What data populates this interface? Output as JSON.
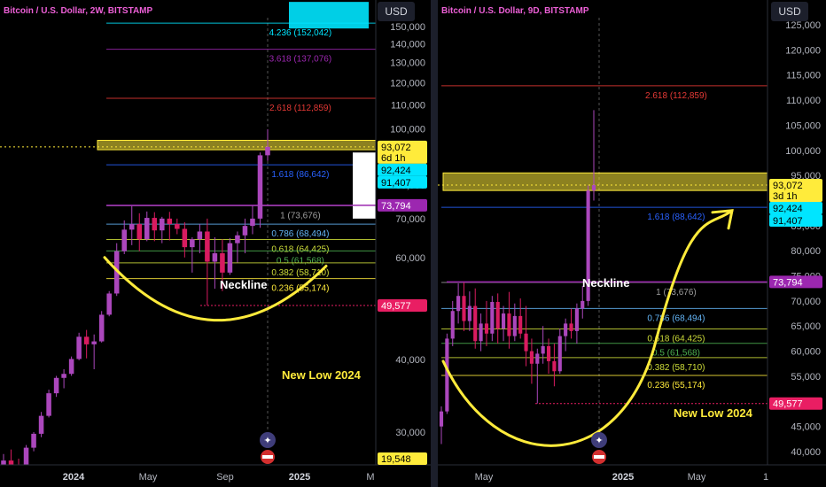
{
  "panels": [
    {
      "name": "left",
      "header": "Bitcoin / U.S. Dollar, 2W, BITSTAMP",
      "currency": "USD",
      "y_ticks": [
        150000,
        140000,
        130000,
        120000,
        110000,
        100000,
        90000,
        80000,
        70000,
        60000,
        50000,
        40000,
        30000
      ],
      "y_tick_labels": [
        "150,000",
        "140,000",
        "130,000",
        "120,000",
        "110,000",
        "100,000",
        "90,000",
        "80,000",
        "70,000",
        "60,000",
        "50,000",
        "40,000",
        "30,000"
      ],
      "x_labels": [
        {
          "text": "2024",
          "bold": true
        },
        {
          "text": "May"
        },
        {
          "text": "Sep"
        },
        {
          "text": "2025",
          "bold": true
        },
        {
          "text": "M"
        }
      ],
      "fib_levels": [
        {
          "label": "4.236 (152,042)",
          "value": 152042,
          "color": "#00e5ff"
        },
        {
          "label": "3.618 (137,076)",
          "value": 137076,
          "color": "#9c27b0"
        },
        {
          "label": "2.618 (112,859)",
          "value": 112859,
          "color": "#e53935"
        },
        {
          "label": "1.618 (86,642)",
          "value": 86642,
          "color": "#2962ff"
        },
        {
          "label": "1 (73,676)",
          "value": 73676,
          "color": "#9e9e9e"
        },
        {
          "label": "0.786 (68,494)",
          "value": 68494,
          "color": "#64b5f6"
        },
        {
          "label": "0.618 (64,425)",
          "value": 64425,
          "color": "#cddc39"
        },
        {
          "label": "0.5 (61,568)",
          "value": 61568,
          "color": "#4caf50"
        },
        {
          "label": "0.382 (58,710)",
          "value": 58710,
          "color": "#cddc39"
        },
        {
          "label": "0.236 (55,174)",
          "value": 55174,
          "color": "#ffeb3b"
        }
      ],
      "neckline_label": "Neckline",
      "new_low_label": "New Low 2024",
      "price_tags": [
        {
          "text": "93,072",
          "sub": "6d 1h",
          "bg": "#ffeb3b",
          "fg": "#000"
        },
        {
          "text": "92,424",
          "bg": "#00e5ff",
          "fg": "#000"
        },
        {
          "text": "91,407",
          "bg": "#00e5ff",
          "fg": "#000"
        },
        {
          "text": "73,794",
          "bg": "#9c27b0",
          "fg": "#fff"
        },
        {
          "text": "49,577",
          "bg": "#e91e63",
          "fg": "#fff"
        },
        {
          "text": "19,548",
          "bg": "#ffeb3b",
          "fg": "#000"
        }
      ]
    },
    {
      "name": "right",
      "header": "Bitcoin / U.S. Dollar, 9D, BITSTAMP",
      "currency": "USD",
      "y_ticks": [
        125000,
        120000,
        115000,
        110000,
        105000,
        100000,
        95000,
        90000,
        85000,
        80000,
        75000,
        70000,
        65000,
        60000,
        55000,
        50000,
        45000,
        40000
      ],
      "y_tick_labels": [
        "125,000",
        "120,000",
        "115,000",
        "110,000",
        "105,000",
        "100,000",
        "95,000",
        "90,000",
        "85,000",
        "80,000",
        "75,000",
        "70,000",
        "65,000",
        "60,000",
        "55,000",
        "50,000",
        "45,000",
        "40,000"
      ],
      "x_labels": [
        {
          "text": "May"
        },
        {
          "text": "2025",
          "bold": true
        },
        {
          "text": "May"
        },
        {
          "text": "1"
        }
      ],
      "fib_levels": [
        {
          "label": "2.618 (112,859)",
          "value": 112859,
          "color": "#e53935"
        },
        {
          "label": "1.618 (88,642)",
          "value": 88642,
          "color": "#2962ff"
        },
        {
          "label": "1 (73,676)",
          "value": 73676,
          "color": "#9e9e9e"
        },
        {
          "label": "0.786 (68,494)",
          "value": 68494,
          "color": "#64b5f6"
        },
        {
          "label": "0.618 (64,425)",
          "value": 64425,
          "color": "#cddc39"
        },
        {
          "label": "0.5 (61,568)",
          "value": 61568,
          "color": "#4caf50"
        },
        {
          "label": "0.382 (58,710)",
          "value": 58710,
          "color": "#cddc39"
        },
        {
          "label": "0.236 (55,174)",
          "value": 55174,
          "color": "#ffeb3b"
        }
      ],
      "neckline_label": "Neckline",
      "new_low_label": "New Low 2024",
      "price_tags": [
        {
          "text": "93,072",
          "sub": "3d 1h",
          "bg": "#ffeb3b",
          "fg": "#000"
        },
        {
          "text": "92,424",
          "bg": "#00e5ff",
          "fg": "#000"
        },
        {
          "text": "91,407",
          "bg": "#00e5ff",
          "fg": "#000"
        },
        {
          "text": "73,794",
          "bg": "#9c27b0",
          "fg": "#fff"
        },
        {
          "text": "49,577",
          "bg": "#e91e63",
          "fg": "#fff"
        }
      ]
    }
  ],
  "chart_data": [
    {
      "type": "candlestick",
      "title": "Bitcoin / U.S. Dollar, 2W, BITSTAMP",
      "ylim": [
        19548,
        152042
      ],
      "y_scale": "log",
      "candles": [
        [
          26000,
          27500,
          25500,
          26800
        ],
        [
          26800,
          28000,
          25800,
          26200
        ],
        [
          26200,
          27000,
          25400,
          26100
        ],
        [
          26100,
          28500,
          26000,
          28200
        ],
        [
          28200,
          30000,
          27800,
          29800
        ],
        [
          29800,
          32500,
          29400,
          32000
        ],
        [
          32000,
          35500,
          31800,
          35000
        ],
        [
          35000,
          37500,
          34500,
          37200
        ],
        [
          37200,
          38500,
          35700,
          37800
        ],
        [
          37800,
          40500,
          37500,
          40100
        ],
        [
          40100,
          44500,
          39900,
          43800
        ],
        [
          43800,
          45000,
          40200,
          42500
        ],
        [
          42500,
          44200,
          38500,
          43000
        ],
        [
          43000,
          48500,
          42800,
          47800
        ],
        [
          47800,
          52500,
          47500,
          52000
        ],
        [
          52000,
          63500,
          51500,
          61500
        ],
        [
          61500,
          69500,
          60800,
          67000
        ],
        [
          67000,
          73600,
          63000,
          68500
        ],
        [
          68500,
          71500,
          61500,
          64500
        ],
        [
          64500,
          72000,
          64000,
          70200
        ],
        [
          70200,
          71800,
          64000,
          66800
        ],
        [
          66800,
          70500,
          63500,
          70000
        ],
        [
          70000,
          71900,
          64200,
          68500
        ],
        [
          68500,
          70000,
          65800,
          67200
        ],
        [
          67200,
          69000,
          60000,
          62500
        ],
        [
          62500,
          65000,
          56500,
          64500
        ],
        [
          64500,
          68500,
          61000,
          66500
        ],
        [
          66500,
          70000,
          49577,
          59000
        ],
        [
          59000,
          65000,
          53000,
          61000
        ],
        [
          61000,
          64500,
          52500,
          56500
        ],
        [
          56500,
          64800,
          56000,
          63500
        ],
        [
          63500,
          66500,
          58800,
          65500
        ],
        [
          65500,
          70000,
          61000,
          68000
        ],
        [
          68000,
          73700,
          65800,
          70000
        ],
        [
          70000,
          91000,
          67500,
          90000
        ],
        [
          90000,
          99800,
          88000,
          93072
        ]
      ],
      "annotations": [
        "Neckline",
        "New Low 2024"
      ]
    },
    {
      "type": "candlestick",
      "title": "Bitcoin / U.S. Dollar, 9D, BITSTAMP",
      "ylim": [
        40000,
        125000
      ],
      "candles": [
        [
          45000,
          49000,
          41500,
          48000
        ],
        [
          48000,
          63500,
          47500,
          62500
        ],
        [
          62500,
          70000,
          61000,
          68000
        ],
        [
          68000,
          73500,
          65500,
          71000
        ],
        [
          71000,
          73700,
          64000,
          66000
        ],
        [
          66000,
          71900,
          64000,
          69000
        ],
        [
          69000,
          72500,
          60500,
          62000
        ],
        [
          62000,
          67500,
          60000,
          65500
        ],
        [
          65500,
          70000,
          61000,
          63500
        ],
        [
          63500,
          71000,
          62000,
          69800
        ],
        [
          69800,
          71500,
          61500,
          64500
        ],
        [
          64500,
          69000,
          62000,
          67500
        ],
        [
          67500,
          71800,
          60500,
          63000
        ],
        [
          63000,
          69500,
          62000,
          67000
        ],
        [
          67000,
          70500,
          62500,
          63500
        ],
        [
          63500,
          69000,
          57000,
          60000
        ],
        [
          60000,
          62500,
          53500,
          57500
        ],
        [
          57500,
          60500,
          49577,
          59500
        ],
        [
          59500,
          65000,
          57500,
          61000
        ],
        [
          61000,
          62500,
          55500,
          58000
        ],
        [
          58000,
          61500,
          53000,
          56000
        ],
        [
          56000,
          64500,
          55500,
          63000
        ],
        [
          63000,
          66500,
          60000,
          65500
        ],
        [
          65500,
          68500,
          62500,
          64000
        ],
        [
          64000,
          69500,
          61500,
          68500
        ],
        [
          68500,
          73000,
          66500,
          70000
        ],
        [
          70000,
          93000,
          69000,
          92000
        ],
        [
          92000,
          108000,
          90000,
          93072
        ]
      ],
      "annotations": [
        "Neckline",
        "New Low 2024"
      ]
    }
  ]
}
